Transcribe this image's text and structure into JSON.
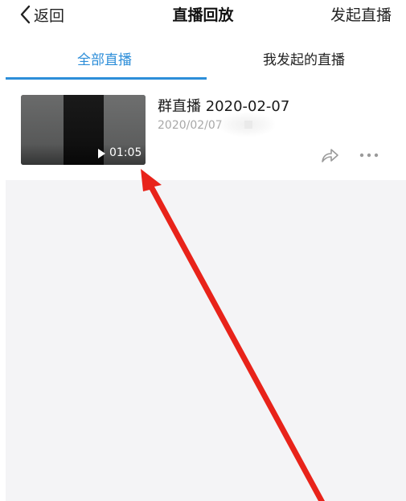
{
  "header": {
    "back_label": "返回",
    "title": "直播回放",
    "action_label": "发起直播"
  },
  "tabs": [
    {
      "label": "全部直播",
      "active": true
    },
    {
      "label": "我发起的直播",
      "active": false
    }
  ],
  "replays": [
    {
      "title": "群直播 2020-02-07",
      "date": "2020/02/07",
      "duration": "01:05"
    }
  ],
  "colors": {
    "accent": "#2d8ed9",
    "annotation_arrow": "#e8231a",
    "empty_background": "#f4f4f6"
  },
  "icons": {
    "back": "chevron-left-icon",
    "play": "play-icon",
    "share": "share-icon",
    "more": "more-icon"
  }
}
